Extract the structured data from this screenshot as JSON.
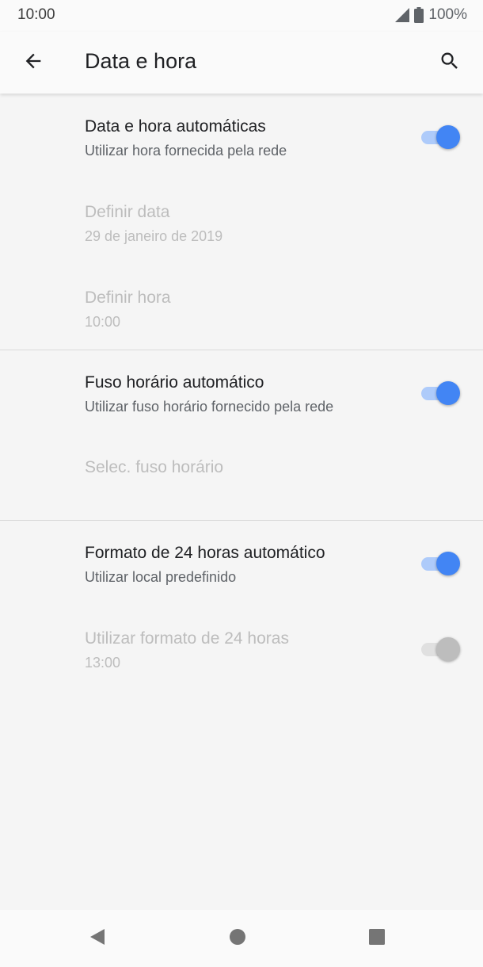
{
  "status_bar": {
    "time": "10:00",
    "battery_text": "100%",
    "icons": [
      "signal-icon",
      "battery-icon"
    ]
  },
  "app_bar": {
    "title": "Data e hora",
    "icons": [
      "back-arrow-icon",
      "search-icon"
    ]
  },
  "settings": {
    "auto_datetime": {
      "title": "Data e hora automáticas",
      "summary": "Utilizar hora fornecida pela rede",
      "toggle_on": true
    },
    "set_date": {
      "title": "Definir data",
      "summary": "29 de janeiro de 2019"
    },
    "set_time": {
      "title": "Definir hora",
      "summary": "10:00"
    },
    "auto_timezone": {
      "title": "Fuso horário automático",
      "summary": "Utilizar fuso horário fornecido pela rede",
      "toggle_on": true
    },
    "select_timezone": {
      "title": "Selec. fuso horário"
    },
    "auto_24h": {
      "title": "Formato de 24 horas automático",
      "summary": "Utilizar local predefinido",
      "toggle_on": true
    },
    "use_24h": {
      "title": "Utilizar formato de 24 horas",
      "summary": "13:00",
      "toggle_on": true
    }
  },
  "nav_bar": {
    "icons": [
      "nav-back-icon",
      "nav-home-icon",
      "nav-recents-icon"
    ]
  },
  "colors": {
    "accent": "#4285f4",
    "accent_track": "#aecbfa",
    "disabled_text": "#bdbdbd",
    "primary_text": "#202124",
    "secondary_text": "#5f6368"
  }
}
